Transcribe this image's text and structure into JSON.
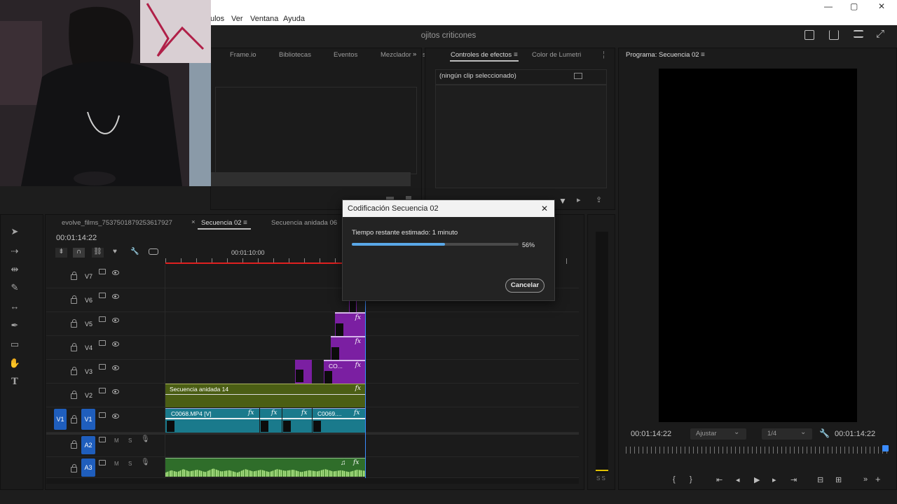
{
  "menu": {
    "items": [
      "ulos",
      "Ver",
      "Ventana",
      "Ayuda"
    ]
  },
  "window_controls": {
    "minimize": "—",
    "maximize": "▢",
    "close": "✕"
  },
  "app": {
    "title": "ojitos criticones"
  },
  "source_panel": {
    "tabs": [
      "Frame.io",
      "Bibliotecas",
      "Eventos",
      "Mezclador"
    ],
    "overflow": "»",
    "extra": "s"
  },
  "effects_panel": {
    "tabs": [
      "Controles de efectos",
      "Color de Lumetri"
    ],
    "active": "Controles de efectos",
    "message": "(ningún clip seleccionado)"
  },
  "program_panel": {
    "title": "Programa: Secuencia 02",
    "timecode_left": "00:01:14:22",
    "timecode_right": "00:01:14:22",
    "fit_label": "Ajustar",
    "resolution": "1/4"
  },
  "timeline": {
    "tabs": [
      "evolve_films_7537501879253617927",
      "Secuencia 02",
      "Secuencia anidada 06"
    ],
    "active_tab": "Secuencia 02",
    "close_glyph": "×",
    "timecode": "00:01:14:22",
    "ruler_label": "00:01:10:00",
    "tracks": [
      "V7",
      "V6",
      "V5",
      "V4",
      "V3",
      "V2",
      "V1",
      "A2",
      "A3"
    ],
    "source_patch": "V1",
    "clips": {
      "v2_nested": "Secuencia anidada 14",
      "v1_main": "C0068.MP4 [V]",
      "v1_end": "C0069....",
      "v3_co": "CO...",
      "fx": "fx"
    },
    "ms_labels": {
      "m": "M",
      "s": "S"
    },
    "meter_labels": "S S"
  },
  "dialog": {
    "title": "Codificación Secuencia 02",
    "status": "Tiempo restante estimado: 1 minuto",
    "progress": 56,
    "progress_label": "56%",
    "cancel": "Cancelar",
    "close": "✕"
  },
  "colors": {
    "accent_blue": "#1f5ebd",
    "clip_purple": "#7b1fa2",
    "clip_olive": "#4b5e14",
    "clip_teal": "#1a7a8c",
    "audio_green": "#2f6d2a",
    "playhead": "#3b8cff"
  }
}
